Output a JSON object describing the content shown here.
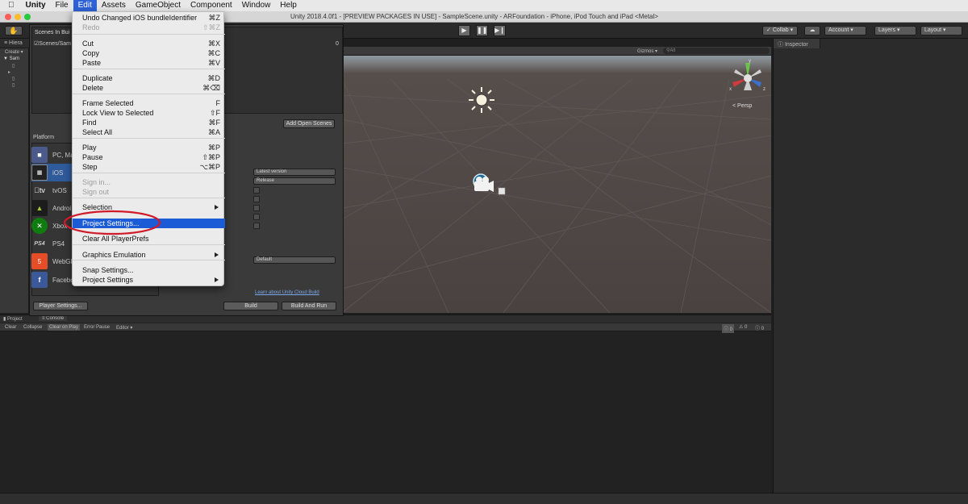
{
  "menubar": {
    "items": [
      "Unity",
      "File",
      "Edit",
      "Assets",
      "GameObject",
      "Component",
      "Window",
      "Help"
    ],
    "active": "Edit"
  },
  "window_title": "Unity 2018.4.0f1 - [PREVIEW PACKAGES IN USE] - SampleScene.unity - ARFoundation - iPhone, iPod Touch and iPad <Metal>",
  "toolbar": {
    "collab": "Collab",
    "account": "Account",
    "layers": "Layers",
    "layout": "Layout"
  },
  "hierarchy": {
    "tab": "Hiera",
    "create": "Create",
    "scene": "Sam"
  },
  "build_settings": {
    "scenes_title": "Scenes In Bui",
    "scene_entry": "Scenes/Sam",
    "scene_index": "0",
    "add_open_scenes": "Add Open Scenes",
    "platform_header": "Platform",
    "platforms": [
      {
        "name": "PC, Ma",
        "icon": "pc-mac-linux-icon"
      },
      {
        "name": "iOS",
        "icon": "ios-icon",
        "selected": true
      },
      {
        "name": "tvOS",
        "icon": "tvos-icon"
      },
      {
        "name": "Androi",
        "icon": "android-icon"
      },
      {
        "name": "Xbox",
        "icon": "xbox-icon"
      },
      {
        "name": "PS4",
        "icon": "ps4-icon"
      },
      {
        "name": "WebGL",
        "icon": "webgl-icon"
      },
      {
        "name": "Facebo",
        "icon": "facebook-icon"
      }
    ],
    "fields": {
      "xcode_version": "Latest version",
      "run_config": "Release",
      "compression": "Default"
    },
    "cloud_link": "Learn about Unity Cloud Build",
    "player_settings": "Player Settings...",
    "build": "Build",
    "build_and_run": "Build And Run"
  },
  "scene_view": {
    "gizmos": "Gizmos",
    "search_prefix": "All",
    "persp": "< Persp",
    "axis_x": "x",
    "axis_y": "y",
    "axis_z": "z"
  },
  "inspector": {
    "tab": "Inspector"
  },
  "console": {
    "tab_project": "Project",
    "tab_console": "Console",
    "buttons": [
      "Clear",
      "Collapse",
      "Clear on Play",
      "Error Pause",
      "Editor"
    ],
    "counts": {
      "info": "0",
      "warnings": "0",
      "errors": "0"
    }
  },
  "edit_menu": {
    "items": [
      {
        "label": "Undo Changed iOS bundleIdentifier",
        "shortcut": "⌘Z"
      },
      {
        "label": "Redo",
        "shortcut": "⇧⌘Z",
        "disabled": true
      },
      {
        "sep": true
      },
      {
        "label": "Cut",
        "shortcut": "⌘X"
      },
      {
        "label": "Copy",
        "shortcut": "⌘C"
      },
      {
        "label": "Paste",
        "shortcut": "⌘V"
      },
      {
        "sep": true
      },
      {
        "label": "Duplicate",
        "shortcut": "⌘D"
      },
      {
        "label": "Delete",
        "shortcut": "⌘⌫"
      },
      {
        "sep": true
      },
      {
        "label": "Frame Selected",
        "shortcut": "F"
      },
      {
        "label": "Lock View to Selected",
        "shortcut": "⇧F"
      },
      {
        "label": "Find",
        "shortcut": "⌘F"
      },
      {
        "label": "Select All",
        "shortcut": "⌘A"
      },
      {
        "sep": true
      },
      {
        "label": "Play",
        "shortcut": "⌘P"
      },
      {
        "label": "Pause",
        "shortcut": "⇧⌘P"
      },
      {
        "label": "Step",
        "shortcut": "⌥⌘P"
      },
      {
        "sep": true
      },
      {
        "label": "Sign in...",
        "disabled": true
      },
      {
        "label": "Sign out",
        "disabled": true
      },
      {
        "sep": true
      },
      {
        "label": "Selection",
        "submenu": true
      },
      {
        "label": "Project Settings...",
        "highlighted": true
      },
      {
        "label": "Clear All PlayerPrefs"
      },
      {
        "sep": true
      },
      {
        "label": "Graphics Emulation",
        "submenu": true
      },
      {
        "sep": true
      },
      {
        "label": "Snap Settings..."
      },
      {
        "label": "Project Settings",
        "submenu": true
      }
    ]
  },
  "colors": {
    "menu_highlight": "#1c5bd6",
    "annotation_circle": "#d01a2a",
    "selected_platform": "#2f5b9b"
  }
}
